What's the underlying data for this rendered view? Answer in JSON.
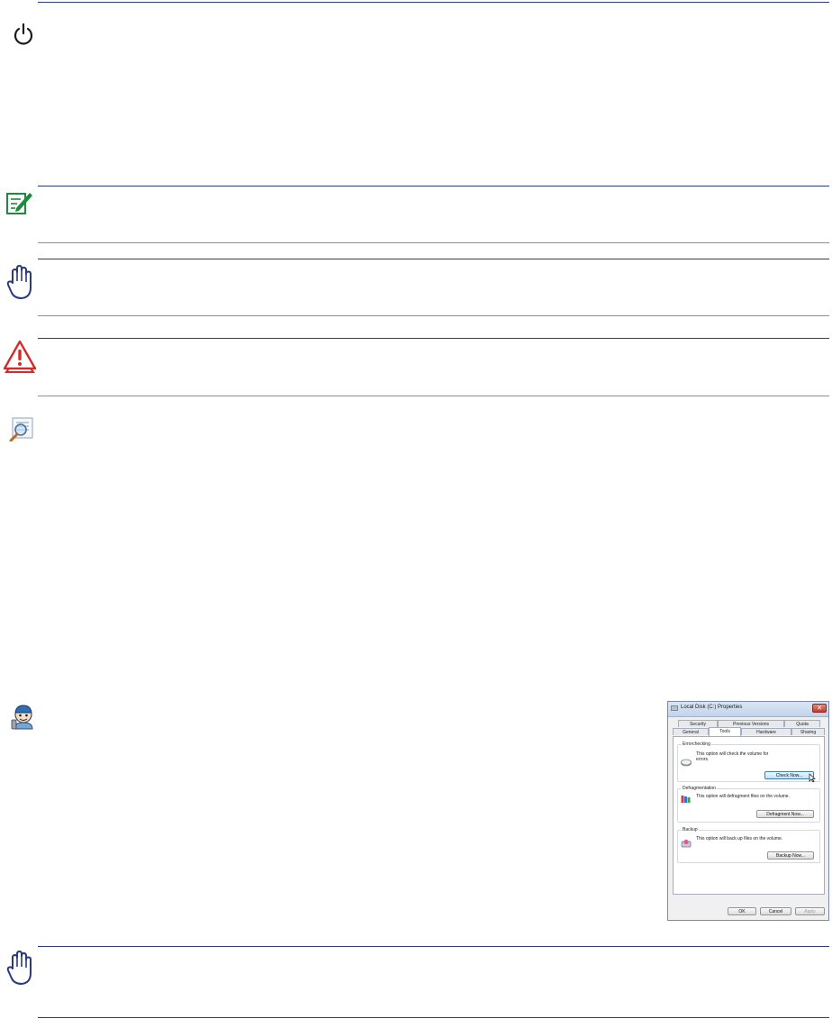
{
  "dialog": {
    "title": "Local Disk (C:) Properties",
    "close_glyph": "✕",
    "tabs_back": [
      "Security",
      "Previous Versions",
      "Quota"
    ],
    "tabs_front": [
      "General",
      "Tools",
      "Hardware",
      "Sharing"
    ],
    "active_tab": "Tools",
    "groups": [
      {
        "label": "Errorchecking",
        "text": "This option will check the volume for errors.",
        "button": "Check Now..."
      },
      {
        "label": "Defragmentation",
        "text": "This option will defragment files on the volume.",
        "button": "Defragment Now..."
      },
      {
        "label": "Backup",
        "text": "This option will back up files on the volume.",
        "button": "Backup Now..."
      }
    ],
    "footer_buttons": [
      "OK",
      "Cancel",
      "Apply"
    ]
  },
  "icons": [
    "power-icon",
    "note-icon",
    "stop-hand-icon",
    "warning-icon",
    "tip-icon",
    "technician-icon",
    "stop-hand-icon"
  ],
  "colors": {
    "rule": "#2b3a7a",
    "note_green": "#1e8a3c",
    "warning_red": "#d32b2b",
    "hand_blue": "#2b3a7a"
  }
}
